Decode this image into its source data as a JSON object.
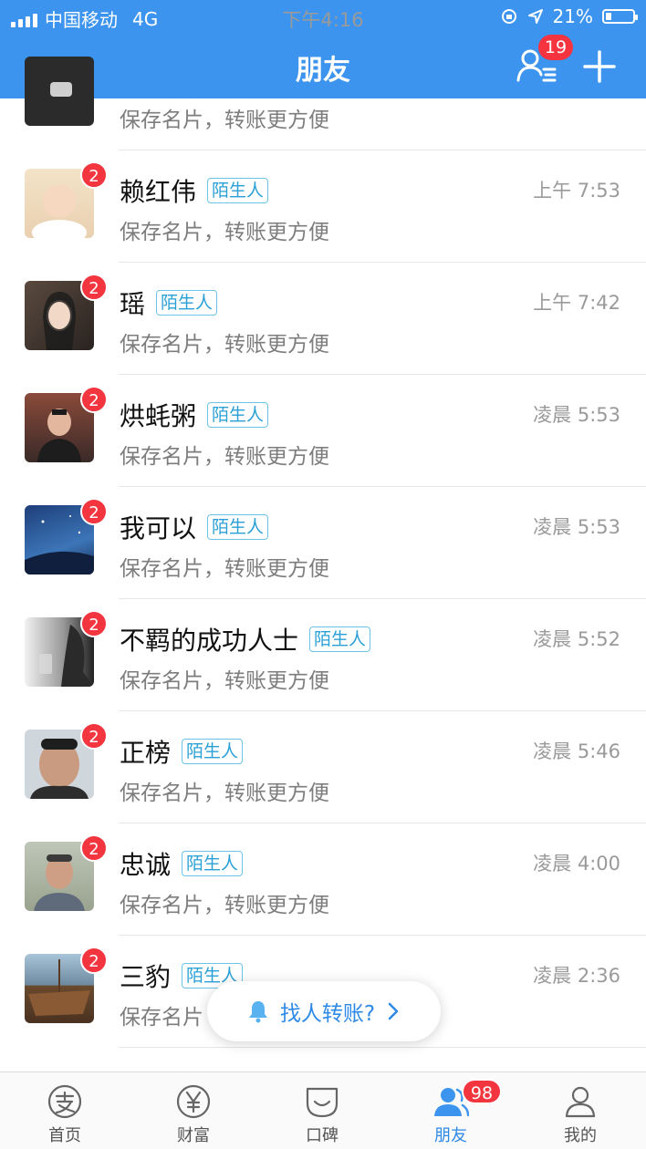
{
  "status_bar": {
    "carrier": "中国移动",
    "network": "4G",
    "time": "下午4:16",
    "battery": "21%"
  },
  "header": {
    "title": "朋友",
    "contacts_badge": "19"
  },
  "list": {
    "rows": [
      {
        "name": "",
        "tag": "",
        "subtitle": "保存名片，转账更方便",
        "time": "",
        "badge": ""
      },
      {
        "name": "赖红伟",
        "tag": "陌生人",
        "subtitle": "保存名片，转账更方便",
        "time": "上午 7:53",
        "badge": "2"
      },
      {
        "name": "瑶",
        "tag": "陌生人",
        "subtitle": "保存名片，转账更方便",
        "time": "上午 7:42",
        "badge": "2"
      },
      {
        "name": "烘蚝粥",
        "tag": "陌生人",
        "subtitle": "保存名片，转账更方便",
        "time": "凌晨 5:53",
        "badge": "2"
      },
      {
        "name": "我可以",
        "tag": "陌生人",
        "subtitle": "保存名片，转账更方便",
        "time": "凌晨 5:53",
        "badge": "2"
      },
      {
        "name": "不羁的成功人士",
        "tag": "陌生人",
        "subtitle": "保存名片，转账更方便",
        "time": "凌晨 5:52",
        "badge": "2"
      },
      {
        "name": "正榜",
        "tag": "陌生人",
        "subtitle": "保存名片，转账更方便",
        "time": "凌晨 5:46",
        "badge": "2"
      },
      {
        "name": "忠诚",
        "tag": "陌生人",
        "subtitle": "保存名片，转账更方便",
        "time": "凌晨 4:00",
        "badge": "2"
      },
      {
        "name": "三豹",
        "tag": "陌生人",
        "subtitle": "保存名片",
        "time": "凌晨 2:36",
        "badge": "2"
      }
    ]
  },
  "floating_button": {
    "label": "找人转账?"
  },
  "tabbar": {
    "tabs": [
      {
        "label": "首页",
        "icon": "alipay-home-icon"
      },
      {
        "label": "财富",
        "icon": "yuan-icon"
      },
      {
        "label": "口碑",
        "icon": "koubei-icon"
      },
      {
        "label": "朋友",
        "icon": "friends-icon"
      },
      {
        "label": "我的",
        "icon": "person-icon"
      }
    ],
    "friends_badge": "98"
  },
  "colors": {
    "primary_blue": "#3d94ee",
    "badge_red": "#f2353f",
    "tag_blue": "#2aa0d6"
  }
}
